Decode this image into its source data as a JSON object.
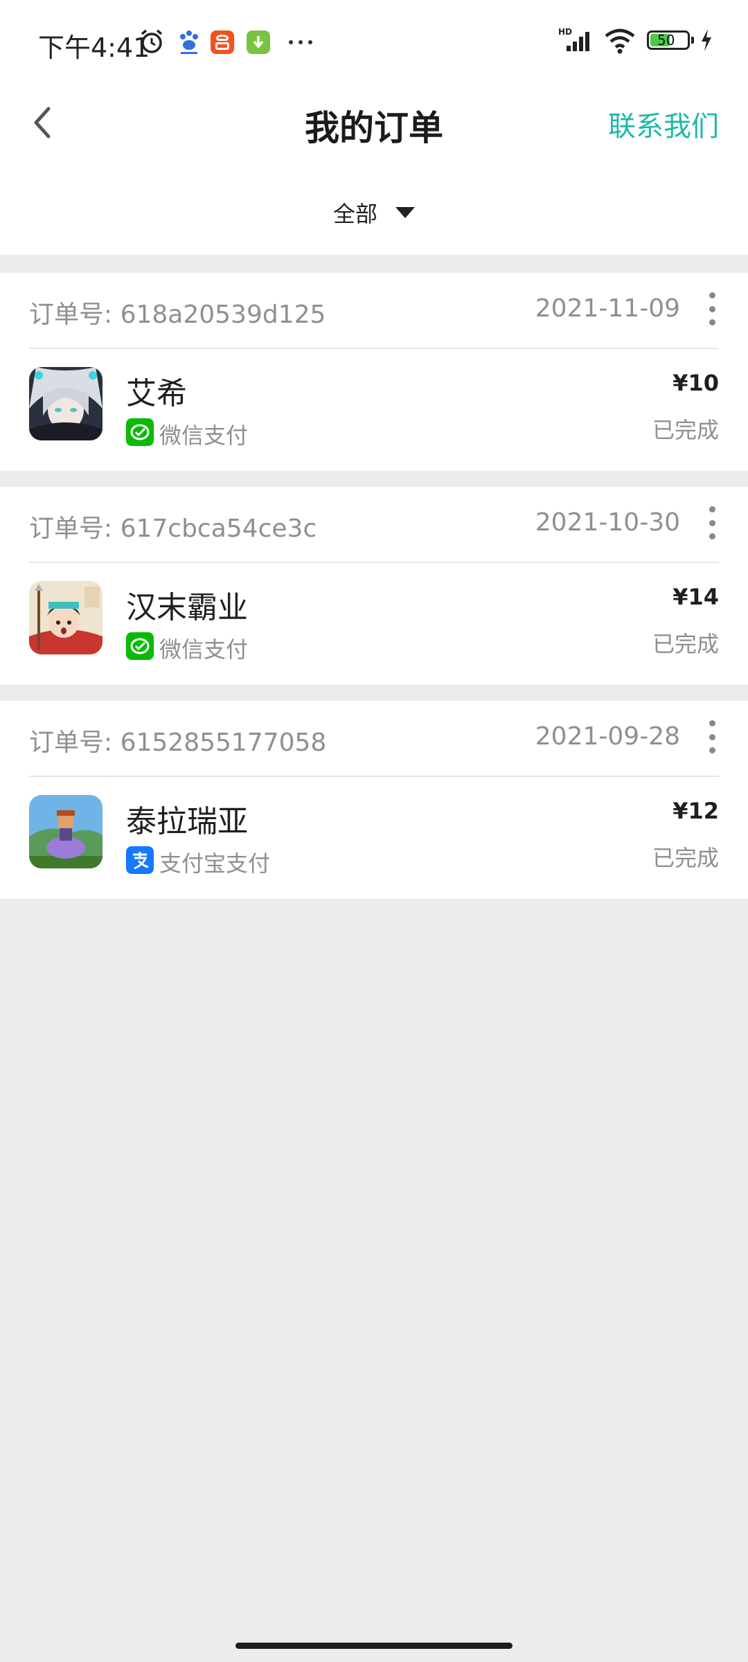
{
  "status_bar": {
    "time": "下午4:41",
    "battery": "50",
    "icons": [
      "alarm-icon",
      "baidu-icon",
      "kuaishou-icon",
      "download-icon",
      "more-icon",
      "hd-signal-icon",
      "wifi-icon",
      "battery-icon",
      "charging-icon"
    ]
  },
  "header": {
    "title": "我的订单",
    "contact_label": "联系我们",
    "accent_color": "#1fb8a8"
  },
  "filter": {
    "label": "全部"
  },
  "orders": [
    {
      "order_id": "订单号: 618a20539d125",
      "date": "2021-11-09",
      "game_name": "艾希",
      "payment_method": "微信支付",
      "payment_icon": "wechat-pay-icon",
      "price": "¥10",
      "status": "已完成"
    },
    {
      "order_id": "订单号: 617cbca54ce3c",
      "date": "2021-10-30",
      "game_name": "汉末霸业",
      "payment_method": "微信支付",
      "payment_icon": "wechat-pay-icon",
      "price": "¥14",
      "status": "已完成"
    },
    {
      "order_id": "订单号: 6152855177058",
      "date": "2021-09-28",
      "game_name": "泰拉瑞亚",
      "payment_method": "支付宝支付",
      "payment_icon": "alipay-icon",
      "price": "¥12",
      "status": "已完成"
    }
  ]
}
